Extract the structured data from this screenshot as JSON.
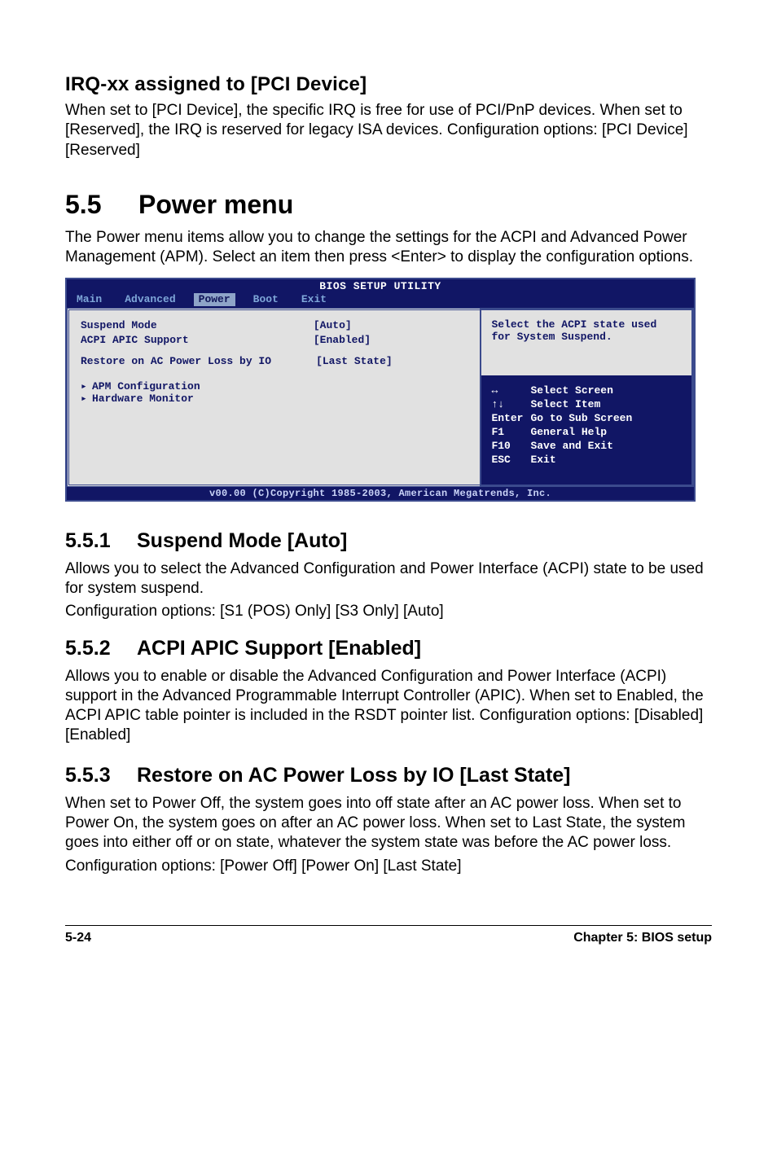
{
  "section_irq": {
    "heading": "IRQ-xx assigned to [PCI Device]",
    "body": "When set to [PCI Device], the specific IRQ is free for use of PCI/PnP devices. When set to [Reserved], the IRQ is reserved for legacy ISA devices. Configuration options: [PCI Device] [Reserved]"
  },
  "section_5_5": {
    "num": "5.5",
    "title": "Power menu",
    "body": "The Power menu items allow you to change the settings for the ACPI and Advanced Power Management (APM). Select an item then press <Enter> to display the configuration options."
  },
  "bios": {
    "title": "BIOS SETUP UTILITY",
    "tabs": [
      "Main",
      "Advanced",
      "Power",
      "Boot",
      "Exit"
    ],
    "selected_tab_index": 2,
    "rows": [
      {
        "label": "Suspend Mode",
        "value": "[Auto]"
      },
      {
        "label": "ACPI APIC Support",
        "value": "[Enabled]"
      },
      {
        "label": "Restore on AC Power Loss by IO",
        "value": "[Last State]"
      }
    ],
    "subitems": [
      "APM Configuration",
      "Hardware Monitor"
    ],
    "help_text": "Select the ACPI state used for System Suspend.",
    "keys": [
      {
        "key": "↔",
        "action": "Select Screen"
      },
      {
        "key": "↑↓",
        "action": "Select Item"
      },
      {
        "key": "Enter",
        "action": "Go to Sub Screen"
      },
      {
        "key": "F1",
        "action": "General Help"
      },
      {
        "key": "F10",
        "action": "Save and Exit"
      },
      {
        "key": "ESC",
        "action": "Exit"
      }
    ],
    "footer": "v00.00 (C)Copyright 1985-2003, American Megatrends, Inc."
  },
  "section_5_5_1": {
    "num": "5.5.1",
    "title": "Suspend Mode [Auto]",
    "body1": "Allows you to select the Advanced Configuration and Power Interface (ACPI) state to be used for system suspend.",
    "body2": "Configuration options: [S1 (POS) Only] [S3 Only] [Auto]"
  },
  "section_5_5_2": {
    "num": "5.5.2",
    "title": "ACPI APIC Support [Enabled]",
    "body": "Allows you to enable or disable the Advanced Configuration and Power Interface (ACPI) support in the Advanced Programmable Interrupt Controller (APIC). When set to Enabled, the ACPI APIC table pointer is included in the RSDT pointer list. Configuration options: [Disabled] [Enabled]"
  },
  "section_5_5_3": {
    "num": "5.5.3",
    "title": "Restore on AC Power Loss by IO [Last State]",
    "body1": "When set to Power Off, the system goes into off state after an AC power loss. When set to Power On, the system goes on after an AC power loss. When set to Last State, the system goes into either off or on state, whatever the system state was before the AC power loss.",
    "body2": "Configuration options: [Power Off] [Power On] [Last State]"
  },
  "footer": {
    "left": "5-24",
    "right": "Chapter 5: BIOS setup"
  }
}
